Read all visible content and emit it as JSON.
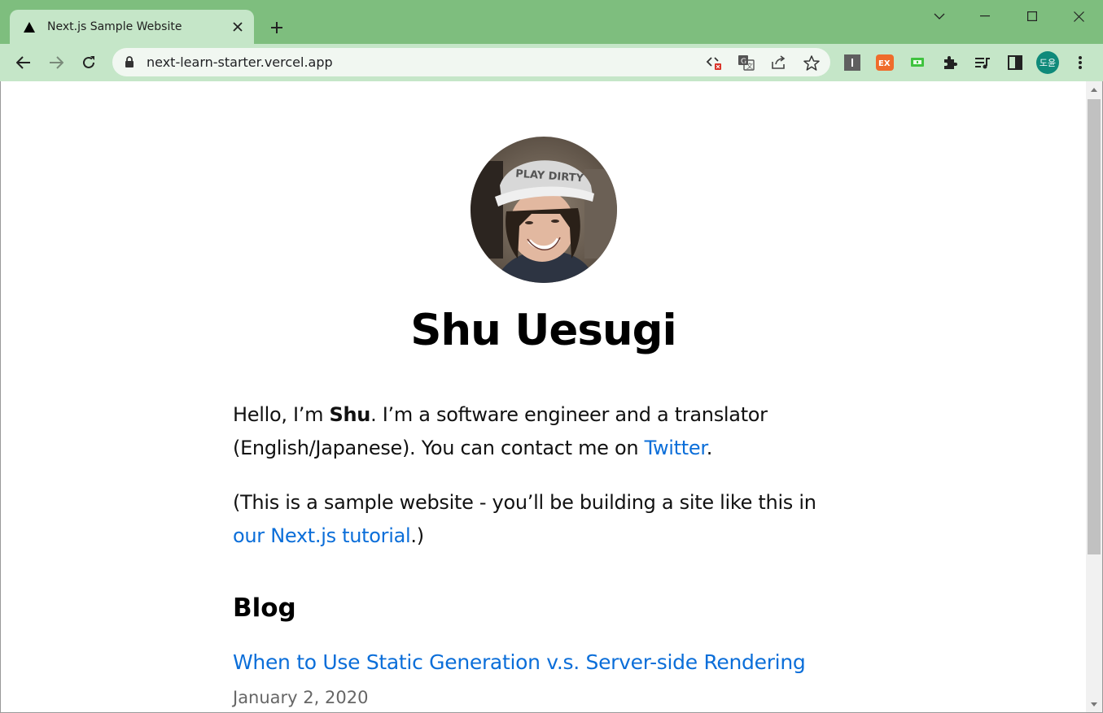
{
  "browser": {
    "tab": {
      "title": "Next.js Sample Website",
      "favicon": "triangle-icon",
      "close_label": "✕"
    },
    "new_tab_label": "+",
    "address": {
      "url": "next-learn-starter.vercel.app"
    },
    "profile_initials": "도윤",
    "extensions": [
      "instapaper-icon",
      "ex-extension-icon",
      "green-extension-icon",
      "puzzle-icon",
      "reading-list-icon",
      "side-panel-icon"
    ]
  },
  "page": {
    "name": "Shu Uesugi",
    "intro": {
      "p1_before": "Hello, I’m ",
      "p1_bold": "Shu",
      "p1_mid": ". I’m a software engineer and a translator (English/Japanese). You can contact me on ",
      "p1_link": "Twitter",
      "p1_after": ".",
      "p2_before": "(This is a sample website - you’ll be building a site like this in ",
      "p2_link": "our Next.js tutorial",
      "p2_after": ".)"
    },
    "blog": {
      "heading": "Blog",
      "posts": [
        {
          "title": "When to Use Static Generation v.s. Server-side Rendering",
          "date": "January 2, 2020"
        }
      ]
    }
  },
  "colors": {
    "titlebar": "#7ebe7e",
    "toolbar": "#c5e6c8",
    "link": "#0b6ed9",
    "profile_bg": "#0f8a7a"
  }
}
